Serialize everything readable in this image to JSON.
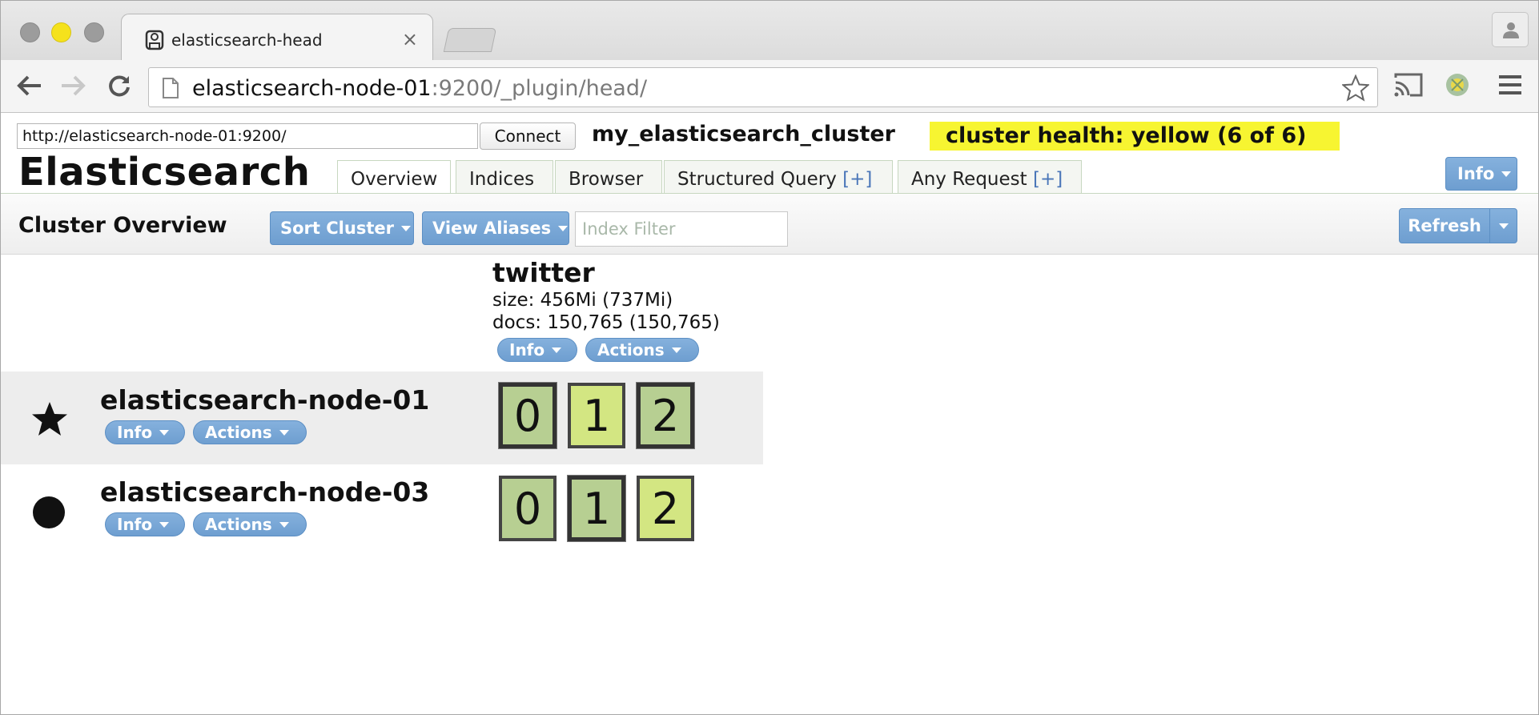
{
  "browser": {
    "tab_title": "elasticsearch-head",
    "tab_close": "×",
    "url_host": "elasticsearch-node-01",
    "url_rest": ":9200/_plugin/head/"
  },
  "head": {
    "connect_url": "http://elasticsearch-node-01:9200/",
    "connect_label": "Connect",
    "cluster_name": "my_elasticsearch_cluster",
    "cluster_health": "cluster health: yellow (6 of 6)",
    "health_color": "#f7f531",
    "brand": "Elasticsearch",
    "info_label": "Info",
    "tabs": [
      {
        "label": "Overview"
      },
      {
        "label": "Indices"
      },
      {
        "label": "Browser"
      },
      {
        "label": "Structured Query",
        "plus": "[+]"
      },
      {
        "label": "Any Request",
        "plus": "[+]"
      }
    ]
  },
  "overview": {
    "title": "Cluster Overview",
    "sort_label": "Sort Cluster",
    "alias_label": "View Aliases",
    "filter_placeholder": "Index Filter",
    "refresh_label": "Refresh"
  },
  "index": {
    "name": "twitter",
    "size": "size: 456Mi (737Mi)",
    "docs": "docs: 150,765 (150,765)",
    "info_label": "Info",
    "actions_label": "Actions"
  },
  "nodes": [
    {
      "name": "elasticsearch-node-01",
      "marker": "star-icon",
      "info_label": "Info",
      "actions_label": "Actions",
      "shards": [
        "0",
        "1",
        "2"
      ],
      "primary": [
        true,
        false,
        true
      ]
    },
    {
      "name": "elasticsearch-node-03",
      "marker": "circle-icon",
      "info_label": "Info",
      "actions_label": "Actions",
      "shards": [
        "0",
        "1",
        "2"
      ],
      "primary": [
        false,
        true,
        false
      ]
    }
  ],
  "colors": {
    "button_blue": "#7aa7d6",
    "shard_green": "#b7cf92",
    "shard_lime": "#d3e682"
  }
}
